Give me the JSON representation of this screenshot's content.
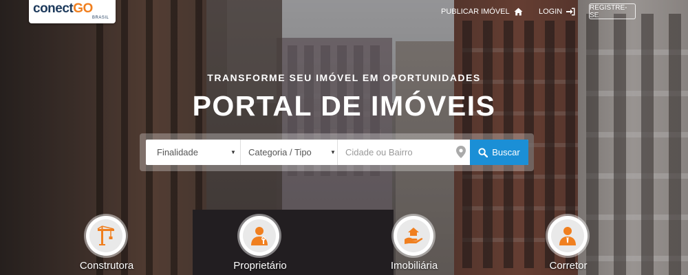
{
  "header": {
    "logo_main": "conect",
    "logo_accent": "GO",
    "logo_sub": "BRASIL",
    "nav": {
      "publish_label": "PUBLICAR IMÓVEL",
      "login_label": "LOGIN",
      "register_label": "REGISTRE-SE"
    }
  },
  "hero": {
    "subtitle": "TRANSFORME SEU IMÓVEL EM OPORTUNIDADES",
    "title": "PORTAL DE IMÓVEIS"
  },
  "search": {
    "purpose_selected": "Finalidade",
    "category_selected": "Categoria / Tipo",
    "city_placeholder": "Cidade ou Bairro",
    "button_label": "Buscar"
  },
  "categories": [
    {
      "label": "Construtora",
      "icon": "crane-icon"
    },
    {
      "label": "Proprietário",
      "icon": "owner-icon"
    },
    {
      "label": "Imobiliária",
      "icon": "house-hand-icon"
    },
    {
      "label": "Corretor",
      "icon": "broker-icon"
    }
  ],
  "colors": {
    "accent_orange": "#f07f1f",
    "brand_navy": "#1d3a5c",
    "search_button": "#1b8fd6"
  }
}
